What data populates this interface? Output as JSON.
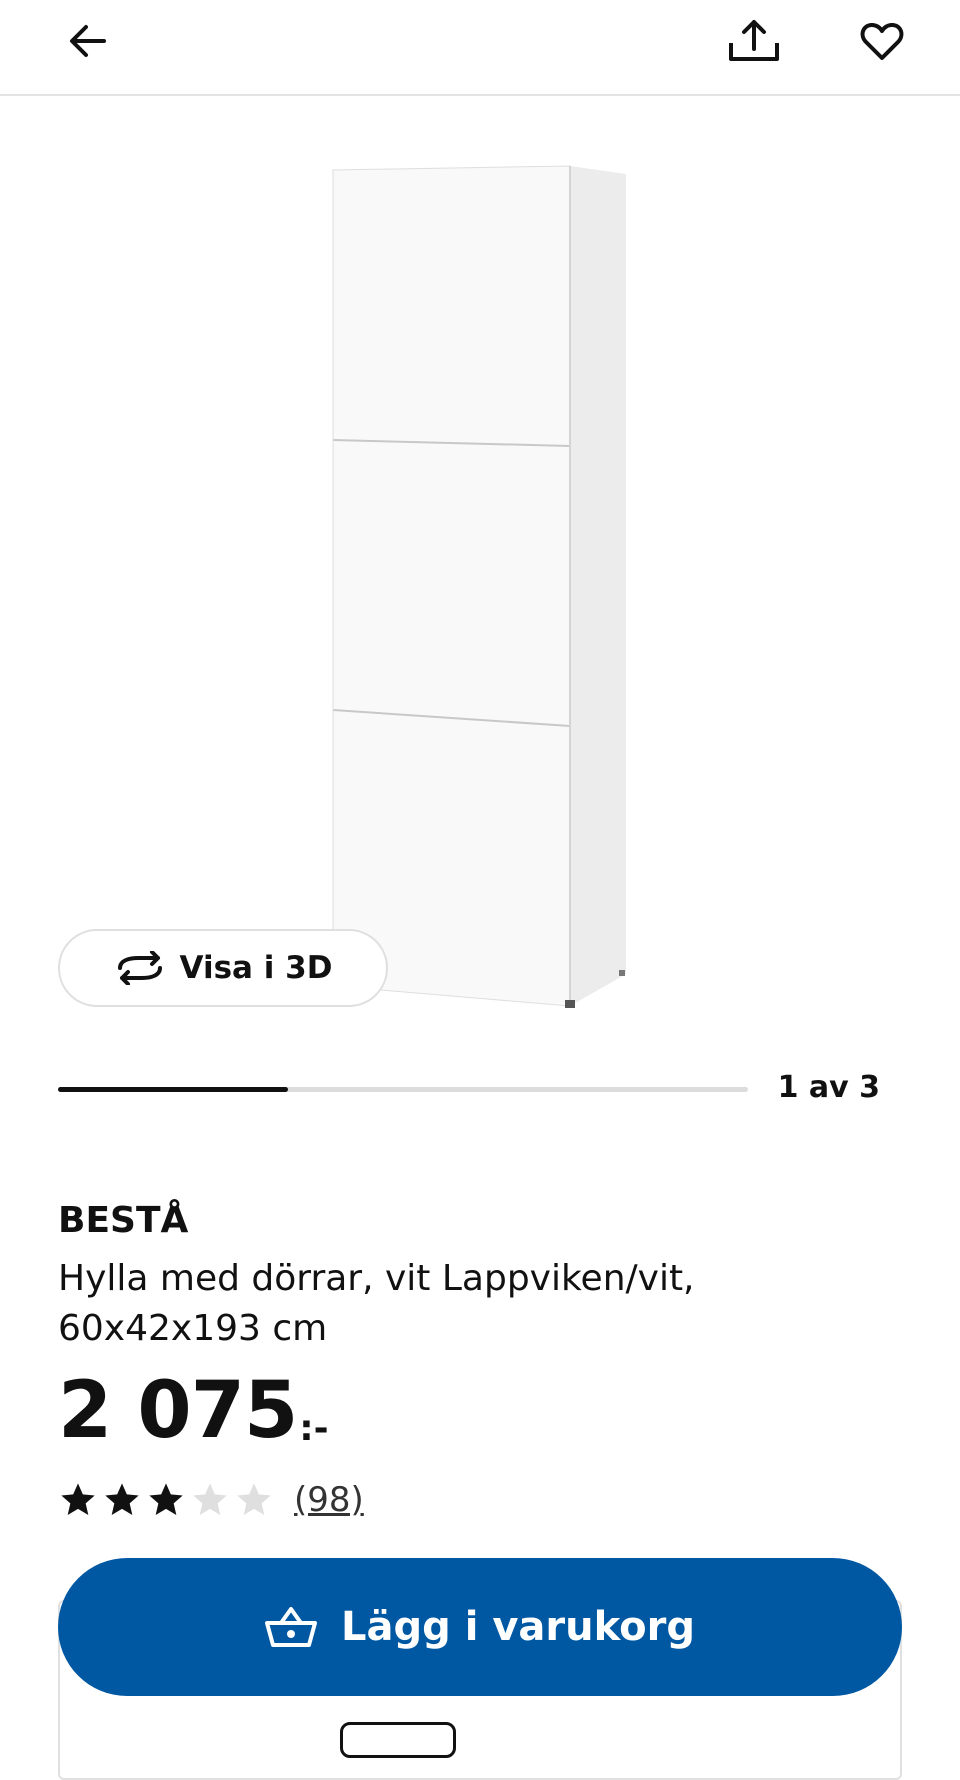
{
  "header": {
    "back_icon": "arrow-left-icon",
    "share_icon": "share-upload-icon",
    "favorite_icon": "heart-outline-icon"
  },
  "gallery": {
    "view_3d_label": "Visa i 3D",
    "view_3d_icon": "rotate-3d-icon",
    "counter": "1 av 3",
    "current_image": 1,
    "total_images": 3
  },
  "product": {
    "brand": "BESTÅ",
    "description": "Hylla med dörrar, vit Lappviken/vit, 60x42x193 cm",
    "price_integer": "2 075",
    "price_suffix": ":-",
    "rating": 3,
    "rating_max": 5,
    "review_count": "(98)"
  },
  "cta": {
    "label": "Lägg i varukorg",
    "icon": "shopping-basket-icon"
  },
  "colors": {
    "accent": "#0058a3",
    "text": "#111111",
    "star_filled": "#111111",
    "star_empty": "#dfdfdf"
  }
}
